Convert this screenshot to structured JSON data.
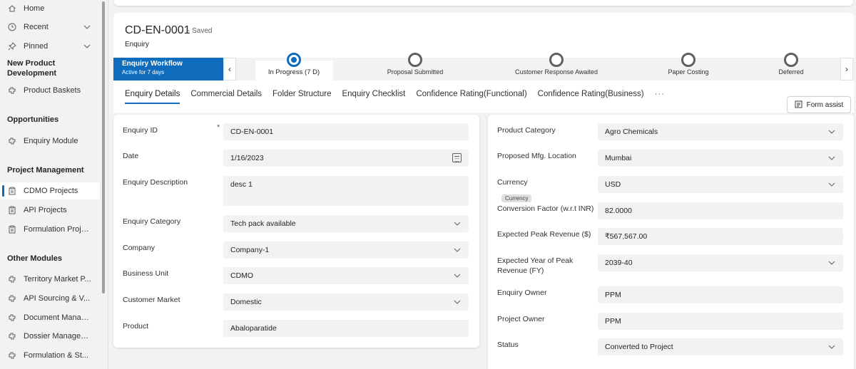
{
  "sidebar": {
    "home": "Home",
    "recent": "Recent",
    "pinned": "Pinned",
    "group_npd": "New Product Development",
    "product_baskets": "Product Baskets",
    "group_opportunities": "Opportunities",
    "enquiry_module": "Enquiry Module",
    "group_project_mgmt": "Project Management",
    "cdmo_projects": "CDMO Projects",
    "api_projects": "API Projects",
    "formulation_projects": "Formulation Proje...",
    "group_other": "Other Modules",
    "territory": "Territory Market P...",
    "api_sourcing": "API Sourcing & V...",
    "document_mgmt": "Document Manag...",
    "dossier_mgmt": "Dossier Managem...",
    "formulation_st": "Formulation & St..."
  },
  "record": {
    "title": "CD-EN-0001",
    "saved": "- Saved",
    "entity": "Enquiry"
  },
  "bpf": {
    "name": "Enquiry Workflow",
    "active_for": "Active for 7 days",
    "stages": [
      {
        "label": "In Progress  (7 D)"
      },
      {
        "label": "Proposal Submitted"
      },
      {
        "label": "Customer Response Awaited"
      },
      {
        "label": "Paper Costing"
      },
      {
        "label": "Deferred"
      }
    ]
  },
  "tabs": [
    "Enquiry Details",
    "Commercial Details",
    "Folder Structure",
    "Enquiry Checklist",
    "Confidence Rating(Functional)",
    "Confidence Rating(Business)",
    "···"
  ],
  "form_assist": "Form assist",
  "left_fields": [
    {
      "label": "Enquiry ID",
      "value": "CD-EN-0001",
      "required": "*"
    },
    {
      "label": "Date",
      "value": "1/16/2023"
    },
    {
      "label": "Enquiry Description",
      "value": "desc 1"
    },
    {
      "label": "Enquiry Category",
      "value": "Tech pack available"
    },
    {
      "label": "Company",
      "value": "Company-1"
    },
    {
      "label": "Business Unit",
      "value": "CDMO"
    },
    {
      "label": "Customer Market",
      "value": "Domestic"
    },
    {
      "label": "Product",
      "value": "Abaloparatide"
    }
  ],
  "right_fields": [
    {
      "label": "Product Category",
      "value": "Agro Chemicals"
    },
    {
      "label": "Proposed Mfg. Location",
      "value": "Mumbai"
    },
    {
      "label": "Currency",
      "value": "USD"
    },
    {
      "label": "Conversion Factor (w.r.t INR)",
      "value": "82.0000"
    },
    {
      "label": "Expected Peak Revenue ($)",
      "value": "₹567,567.00"
    },
    {
      "label": "Expected Year of Peak Revenue (FY)",
      "value": "2039-40"
    },
    {
      "label": "Enquiry Owner",
      "value": "PPM"
    },
    {
      "label": "Project Owner",
      "value": "PPM"
    },
    {
      "label": "Status",
      "value": "Converted to Project"
    }
  ],
  "tooltip": "Currency"
}
